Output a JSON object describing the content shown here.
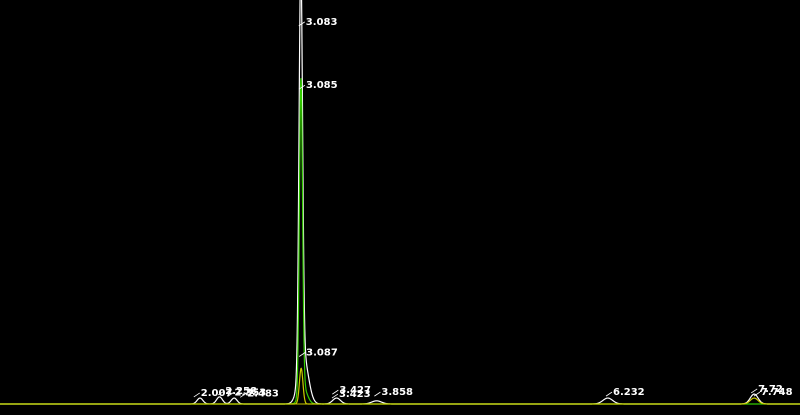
{
  "chart_data": {
    "type": "line",
    "title": "",
    "xlabel": "",
    "ylabel": "",
    "xlim": [
      0.0,
      8.2
    ],
    "ylim": [
      0,
      100
    ],
    "grid": false,
    "legend": "none",
    "series": [
      {
        "color": "#ffffff",
        "peaks": [
          {
            "rt": 2.05,
            "height": 1.5,
            "width": 0.03
          },
          {
            "rt": 2.25,
            "height": 1.8,
            "width": 0.03
          },
          {
            "rt": 2.4,
            "height": 1.5,
            "width": 0.03
          },
          {
            "rt": 3.083,
            "height": 101,
            "width": 0.018
          },
          {
            "rt": 3.11,
            "height": 12,
            "width": 0.05
          },
          {
            "rt": 3.45,
            "height": 1.5,
            "width": 0.04
          },
          {
            "rt": 3.86,
            "height": 0.8,
            "width": 0.05
          },
          {
            "rt": 6.23,
            "height": 1.5,
            "width": 0.05
          },
          {
            "rt": 7.73,
            "height": 2.5,
            "width": 0.04
          }
        ]
      },
      {
        "color": "#33cc00",
        "peaks": [
          {
            "rt": 3.085,
            "height": 79,
            "width": 0.016
          },
          {
            "rt": 3.11,
            "height": 4,
            "width": 0.04
          }
        ]
      },
      {
        "color": "#cccc00",
        "peaks": [
          {
            "rt": 3.087,
            "height": 9,
            "width": 0.018
          },
          {
            "rt": 7.73,
            "height": 1.5,
            "width": 0.04
          }
        ]
      }
    ],
    "annotations": [
      {
        "text": "3.083",
        "rt": 3.083,
        "y": 96.5
      },
      {
        "text": "3.085",
        "rt": 3.085,
        "y": 80.5
      },
      {
        "text": "3.087",
        "rt": 3.087,
        "y": 13.0
      },
      {
        "text": "2.007",
        "rt": 2.007,
        "y": 2.8
      },
      {
        "text": "2.258",
        "rt": 2.258,
        "y": 3.3
      },
      {
        "text": "2.353",
        "rt": 2.353,
        "y": 2.9
      },
      {
        "text": "2.483",
        "rt": 2.483,
        "y": 2.7
      },
      {
        "text": "3.427",
        "rt": 3.427,
        "y": 3.5
      },
      {
        "text": "3.423",
        "rt": 3.423,
        "y": 2.5
      },
      {
        "text": "3.858",
        "rt": 3.858,
        "y": 3.0
      },
      {
        "text": "6.232",
        "rt": 6.232,
        "y": 3.0
      },
      {
        "text": "7.72",
        "rt": 7.72,
        "y": 3.8
      },
      {
        "text": "7.748",
        "rt": 7.748,
        "y": 3.0
      }
    ]
  }
}
